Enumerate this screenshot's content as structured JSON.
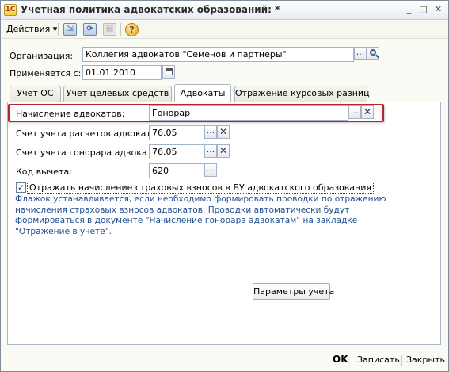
{
  "window": {
    "title": "Учетная политика адвокатских образований: *",
    "icon_label": "1С",
    "controls": {
      "minimize": "_",
      "maximize": "□",
      "close": "✕"
    }
  },
  "toolbar": {
    "actions_label": "Действия",
    "actions_arrow": "▾",
    "icons": [
      "copy-icon",
      "refresh-icon",
      "document-icon",
      "help-icon"
    ],
    "help_glyph": "?"
  },
  "form": {
    "organization_label": "Организация:",
    "organization_value": "Коллегия адвокатов \"Семенов и партнеры\"",
    "applies_from_label": "Применяется с:",
    "applies_from_value": "01.01.2010",
    "select_glyph": "...",
    "clear_glyph": "✕"
  },
  "tabs": [
    {
      "label": "Учет ОС",
      "active": false
    },
    {
      "label": "Учет целевых средств",
      "active": false
    },
    {
      "label": "Адвокаты",
      "active": true
    },
    {
      "label": "Отражение курсовых разниц",
      "active": false
    }
  ],
  "advocates_tab": {
    "accrual_label": "Начисление адвокатов:",
    "accrual_value": "Гонорар",
    "settlements_account_label": "Счет учета расчетов адвокатов:",
    "settlements_account_value": "76.05",
    "fee_account_label": "Счет учета гонорара адвокатов:",
    "fee_account_value": "76.05",
    "deduction_code_label": "Код вычета:",
    "deduction_code_value": "620",
    "insurance_checkbox_label": "Отражать начисление страховых взносов в БУ адвокатского образования",
    "insurance_checkbox_checked": true,
    "note_lines": [
      "Флажок устанавливается, если необходимо формировать проводки по отражению",
      "начисления страховых взносов адвокатов. Проводки автоматически будут",
      "формироваться в документе \"Начисление гонорара адвокатам\" на закладке",
      "\"Отражение в учете\"."
    ],
    "params_button_label": "Параметры учета"
  },
  "footer": {
    "ok_label": "OK",
    "save_label": "Записать",
    "close_label": "Закрыть"
  },
  "colors": {
    "highlight_border": "#b3262f",
    "note_text": "#1f4e91",
    "window_bg": "#fbfbf5"
  }
}
